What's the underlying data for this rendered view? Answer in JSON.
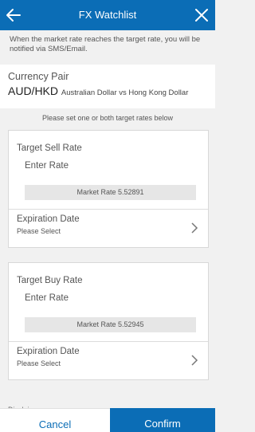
{
  "header": {
    "title": "FX Watchlist",
    "back_icon": "back-arrow-icon",
    "close_icon": "close-icon"
  },
  "notice": "When the market rate reaches the target rate, you will be notified via SMS/Email.",
  "currency_pair": {
    "label": "Currency Pair",
    "code": "AUD/HKD",
    "description": "Australian Dollar vs Hong Kong Dollar"
  },
  "hint": "Please set one or both target rates below",
  "sell": {
    "label": "Target Sell Rate",
    "placeholder": "Enter Rate",
    "market_rate": "Market Rate 5.52891",
    "expiration_label": "Expiration Date",
    "expiration_value": "Please Select"
  },
  "buy": {
    "label": "Target Buy Rate",
    "placeholder": "Enter Rate",
    "market_rate": "Market Rate 5.52945",
    "expiration_label": "Expiration Date",
    "expiration_value": "Please Select"
  },
  "peek_text": "Disclaimer",
  "footer": {
    "cancel": "Cancel",
    "confirm": "Confirm"
  },
  "colors": {
    "brand": "#0b6db6",
    "background": "#f1f1f1"
  }
}
